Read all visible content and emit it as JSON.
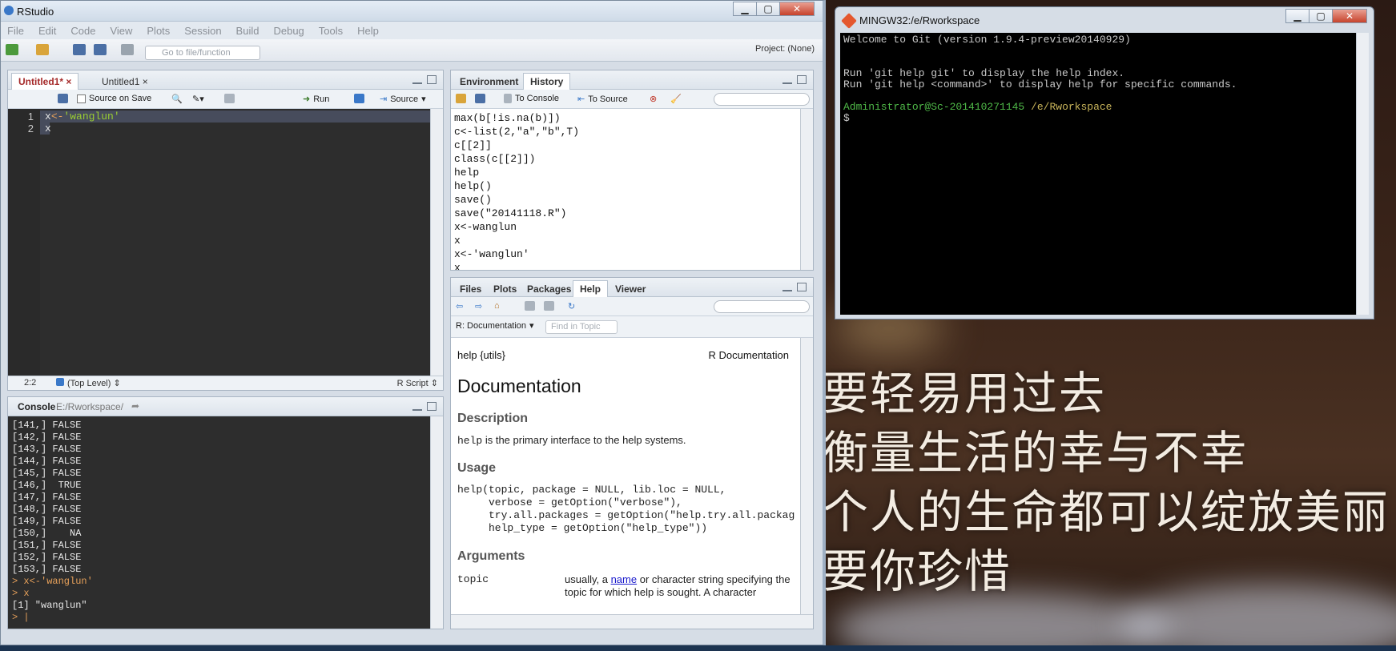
{
  "rstudio": {
    "title": "RStudio",
    "menu": [
      "File",
      "Edit",
      "Code",
      "View",
      "Plots",
      "Session",
      "Build",
      "Debug",
      "Tools",
      "Help"
    ],
    "goto_placeholder": "Go to file/function",
    "project": "Project: (None)",
    "editor": {
      "tabs": [
        "Untitled1*",
        "Untitled1"
      ],
      "source_on_save": "Source on Save",
      "run": "Run",
      "source": "Source",
      "line_numbers": [
        "1",
        "2"
      ],
      "line1_var": "x",
      "line1_op": "<-",
      "line1_str": "'wanglun'",
      "line2": "x",
      "cursor_pos": "2:2",
      "scope": "(Top Level)",
      "file_type": "R Script"
    },
    "console": {
      "label": "Console",
      "path": "E:/Rworkspace/",
      "lines": [
        "[141,] FALSE",
        "[142,] FALSE",
        "[143,] FALSE",
        "[144,] FALSE",
        "[145,] FALSE",
        "[146,]  TRUE",
        "[147,] FALSE",
        "[148,] FALSE",
        "[149,] FALSE",
        "[150,]    NA",
        "[151,] FALSE",
        "[152,] FALSE",
        "[153,] FALSE"
      ],
      "cmd1": "> x<-'wanglun'",
      "cmd2": "> x",
      "result": "[1] \"wanglun\"",
      "prompt": ">"
    },
    "history": {
      "tabs": [
        "Environment",
        "History"
      ],
      "to_console": "To Console",
      "to_source": "To Source",
      "lines": [
        "max(b[!is.na(b)])",
        "c<-list(2,\"a\",\"b\",T)",
        "c[[2]]",
        "class(c[[2]])",
        "help",
        "help()",
        "save()",
        "save(\"20141118.R\")",
        "x<-wanglun",
        "x",
        "x<-'wanglun'",
        "x"
      ]
    },
    "help": {
      "tabs": [
        "Files",
        "Plots",
        "Packages",
        "Help",
        "Viewer"
      ],
      "topic_dropdown": "R: Documentation",
      "find_placeholder": "Find in Topic",
      "meta_left": "help {utils}",
      "meta_right": "R Documentation",
      "title": "Documentation",
      "description_heading": "Description",
      "description_code": "help",
      "description_text": " is the primary interface to the help systems.",
      "usage_heading": "Usage",
      "usage_code": "help(topic, package = NULL, lib.loc = NULL,\n     verbose = getOption(\"verbose\"),\n     try.all.packages = getOption(\"help.try.all.packag\n     help_type = getOption(\"help_type\"))",
      "arguments_heading": "Arguments",
      "arg_name": "topic",
      "arg_desc_pre": "usually, a ",
      "arg_desc_link": "name",
      "arg_desc_post": " or character string specifying the topic for which help is sought. A character"
    }
  },
  "git": {
    "title": "MINGW32:/e/Rworkspace",
    "welcome": "Welcome to Git (version 1.9.4-preview20140929)",
    "help1": "Run 'git help git' to display the help index.",
    "help2": "Run 'git help <command>' to display help for specific commands.",
    "user": "Administrator@Sc-201410271145",
    "cwd": "/e/Rworkspace",
    "prompt": "$"
  },
  "desktop": {
    "lyrics": [
      "要轻易用过去",
      "衡量生活的幸与不幸",
      "个人的生命都可以绽放美丽",
      "要你珍惜"
    ]
  }
}
